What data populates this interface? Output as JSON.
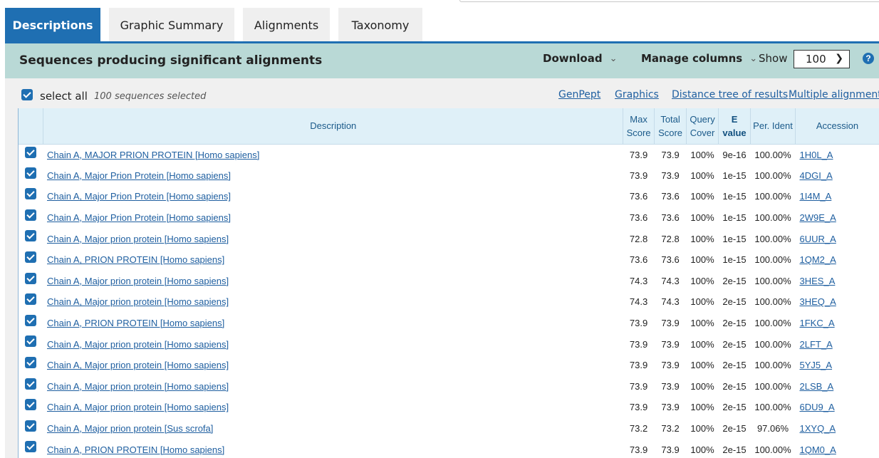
{
  "tabs": [
    "Descriptions",
    "Graphic Summary",
    "Alignments",
    "Taxonomy"
  ],
  "header": {
    "title": "Sequences producing significant alignments",
    "download": "Download",
    "manage_columns": "Manage columns",
    "show_label": "Show",
    "show_value": "100",
    "help": "?"
  },
  "selection": {
    "select_all": "select all",
    "count": "100 sequences selected",
    "links": [
      "GenPept",
      "Graphics",
      "Distance tree of results",
      "Multiple alignment"
    ]
  },
  "table": {
    "columns": [
      "Description",
      "Max Score",
      "Total Score",
      "Query Cover",
      "E value",
      "Per. Ident",
      "Accession"
    ],
    "rows": [
      {
        "description": "Chain A, MAJOR PRION PROTEIN [Homo sapiens]",
        "max": "73.9",
        "total": "73.9",
        "cover": "100%",
        "evalue": "9e-16",
        "ident": "100.00%",
        "accession": "1H0L_A"
      },
      {
        "description": "Chain A, Major Prion Protein [Homo sapiens]",
        "max": "73.9",
        "total": "73.9",
        "cover": "100%",
        "evalue": "1e-15",
        "ident": "100.00%",
        "accession": "4DGI_A"
      },
      {
        "description": "Chain A, Major Prion Protein [Homo sapiens]",
        "max": "73.6",
        "total": "73.6",
        "cover": "100%",
        "evalue": "1e-15",
        "ident": "100.00%",
        "accession": "1I4M_A"
      },
      {
        "description": "Chain A, Major Prion Protein [Homo sapiens]",
        "max": "73.6",
        "total": "73.6",
        "cover": "100%",
        "evalue": "1e-15",
        "ident": "100.00%",
        "accession": "2W9E_A"
      },
      {
        "description": "Chain A, Major prion protein [Homo sapiens]",
        "max": "72.8",
        "total": "72.8",
        "cover": "100%",
        "evalue": "1e-15",
        "ident": "100.00%",
        "accession": "6UUR_A"
      },
      {
        "description": "Chain A, PRION PROTEIN [Homo sapiens]",
        "max": "73.6",
        "total": "73.6",
        "cover": "100%",
        "evalue": "1e-15",
        "ident": "100.00%",
        "accession": "1QM2_A"
      },
      {
        "description": "Chain A, Major prion protein [Homo sapiens]",
        "max": "74.3",
        "total": "74.3",
        "cover": "100%",
        "evalue": "2e-15",
        "ident": "100.00%",
        "accession": "3HES_A"
      },
      {
        "description": "Chain A, Major prion protein [Homo sapiens]",
        "max": "74.3",
        "total": "74.3",
        "cover": "100%",
        "evalue": "2e-15",
        "ident": "100.00%",
        "accession": "3HEQ_A"
      },
      {
        "description": "Chain A, PRION PROTEIN [Homo sapiens]",
        "max": "73.9",
        "total": "73.9",
        "cover": "100%",
        "evalue": "2e-15",
        "ident": "100.00%",
        "accession": "1FKC_A"
      },
      {
        "description": "Chain A, Major prion protein [Homo sapiens]",
        "max": "73.9",
        "total": "73.9",
        "cover": "100%",
        "evalue": "2e-15",
        "ident": "100.00%",
        "accession": "2LFT_A"
      },
      {
        "description": "Chain A, Major prion protein [Homo sapiens]",
        "max": "73.9",
        "total": "73.9",
        "cover": "100%",
        "evalue": "2e-15",
        "ident": "100.00%",
        "accession": "5YJ5_A"
      },
      {
        "description": "Chain A, Major prion protein [Homo sapiens]",
        "max": "73.9",
        "total": "73.9",
        "cover": "100%",
        "evalue": "2e-15",
        "ident": "100.00%",
        "accession": "2LSB_A"
      },
      {
        "description": "Chain A, Major prion protein [Homo sapiens]",
        "max": "73.9",
        "total": "73.9",
        "cover": "100%",
        "evalue": "2e-15",
        "ident": "100.00%",
        "accession": "6DU9_A"
      },
      {
        "description": "Chain A, Major prion protein [Sus scrofa]",
        "max": "73.2",
        "total": "73.2",
        "cover": "100%",
        "evalue": "2e-15",
        "ident": "97.06%",
        "accession": "1XYQ_A"
      },
      {
        "description": "Chain A, PRION PROTEIN [Homo sapiens]",
        "max": "73.9",
        "total": "73.9",
        "cover": "100%",
        "evalue": "2e-15",
        "ident": "100.00%",
        "accession": "1QM0_A"
      }
    ]
  },
  "colors": {
    "accent": "#1f6fb2",
    "header_band": "#b9d9d6",
    "link": "#1f5fa0",
    "table_header": "#dff0f8"
  }
}
